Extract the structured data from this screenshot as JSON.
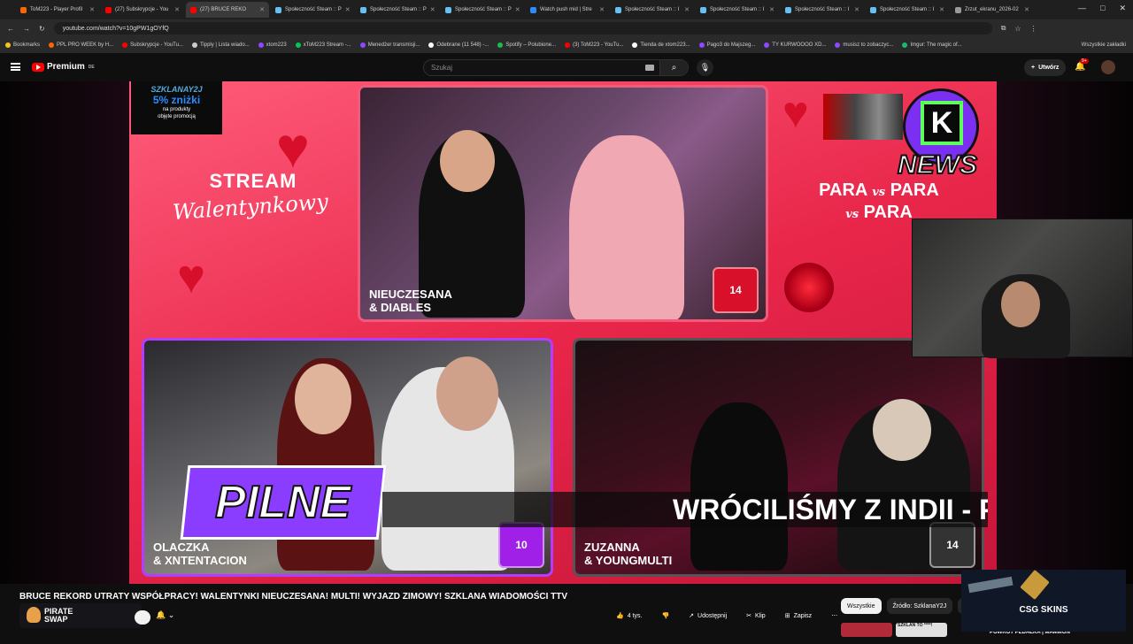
{
  "browser": {
    "tabs": [
      {
        "label": "ToM223 - Player Profil",
        "color": "#ff6600"
      },
      {
        "label": "(27) Subskrypcje - You",
        "color": "#ff0000"
      },
      {
        "label": "(27) BRUCE REKO",
        "color": "#ff0000",
        "active": true
      },
      {
        "label": "Społeczność Steam :: P",
        "color": "#66c0f4"
      },
      {
        "label": "Społeczność Steam :: P",
        "color": "#66c0f4"
      },
      {
        "label": "Społeczność Steam :: P",
        "color": "#66c0f4"
      },
      {
        "label": "Watch push mid | Stre",
        "color": "#2a8cff"
      },
      {
        "label": "Społeczność Steam :: I",
        "color": "#66c0f4"
      },
      {
        "label": "Społeczność Steam :: I",
        "color": "#66c0f4"
      },
      {
        "label": "Społeczność Steam :: I",
        "color": "#66c0f4"
      },
      {
        "label": "Społeczność Steam :: I",
        "color": "#66c0f4"
      },
      {
        "label": "Zrzut_ekranu_2026-02",
        "color": "#999999"
      }
    ],
    "url": "youtube.com/watch?v=10gPW1gOYfQ",
    "bookmarks": [
      "Bookmarks",
      "PPL PRO WEEK by H...",
      "Subskrypcje - YouTu...",
      "Tipply | Lista wiado...",
      "xtom223",
      "xToM223 Stream -...",
      "Menedżer transmisji...",
      "Odebrane (11 548) -...",
      "Spotify – Polubione...",
      "(3) ToM223 - YouTu...",
      "Tienda de xtom223...",
      "Pago3 do Majszeg...",
      "TY KURWOOOO XD...",
      "musisz to zobaczyc...",
      "Imgur: The magic of..."
    ],
    "all_bookmarks": "Wszystkie zakładki"
  },
  "youtube": {
    "logo": "Premium",
    "logo_region": "DE",
    "search_placeholder": "Szukaj",
    "create_label": "Utwórz",
    "notif_badge": "9+"
  },
  "video": {
    "promo_code": "SZKLANAY2J",
    "promo_pct": "5% zniżki",
    "promo_desc1": "na produkty",
    "promo_desc2": "objęte promocją",
    "stream_title": "STREAM",
    "stream_script": "Walentynkowy",
    "news_letter": "K",
    "news_word": "NEWS",
    "para_line1": "PARA",
    "para_line2": "PARA",
    "para_line3": "PARA",
    "vs": "vs",
    "pairs": [
      {
        "line1": "NIEUCZESANA",
        "line2": "& DIABLES",
        "score": "14",
        "score_color": "#d8102a"
      },
      {
        "line1": "OLACZKA",
        "line2": "& XNTENTACION",
        "score": "10",
        "score_color": "#a020e8"
      },
      {
        "line1": "ZUZANNA",
        "line2": "& YOUNGMULTI",
        "score": "14",
        "score_color": "#333333"
      }
    ],
    "pilne": "PILNE",
    "ticker": "WRÓCILIŚMY Z INDII - PA"
  },
  "meta": {
    "title": "BRUCE REKORD UTRATY WSPÓŁPRACY! WALENTYNKI NIEUCZESANA! MULTI! WYJAZD ZIMOWY! SZKLANA WIADOMOŚCI TTV",
    "sponsor_line1": "PIRATE",
    "sponsor_line2": "SWAP",
    "likes": "4 tys.",
    "share": "Udostępnij",
    "clip": "Klip",
    "save": "Zapisz",
    "chips": [
      "Wszystkie",
      "Źródło: SzklanaY2J",
      "P"
    ],
    "ad_brand": "CSG SKINS",
    "suggested": "POWRÓT PEDAŁKA | MAMMON",
    "suggested_thumb": "SZKLAN TO ****!"
  }
}
